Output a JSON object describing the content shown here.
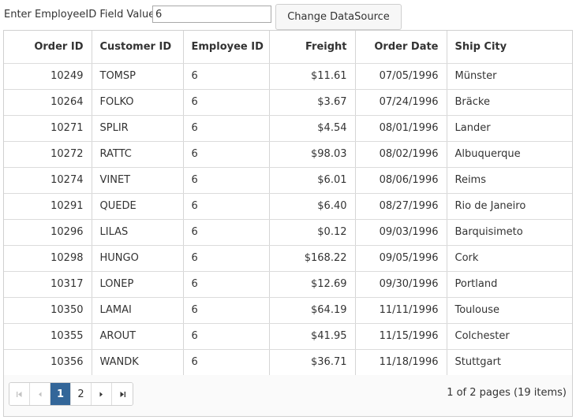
{
  "toolbar": {
    "label": "Enter EmployeeID Field Value:",
    "input_value": "6",
    "button_label": "Change DataSource"
  },
  "grid": {
    "columns": [
      "Order ID",
      "Customer ID",
      "Employee ID",
      "Freight",
      "Order Date",
      "Ship City"
    ],
    "rows": [
      [
        "10249",
        "TOMSP",
        "6",
        "$11.61",
        "07/05/1996",
        "Münster"
      ],
      [
        "10264",
        "FOLKO",
        "6",
        "$3.67",
        "07/24/1996",
        "Bräcke"
      ],
      [
        "10271",
        "SPLIR",
        "6",
        "$4.54",
        "08/01/1996",
        "Lander"
      ],
      [
        "10272",
        "RATTC",
        "6",
        "$98.03",
        "08/02/1996",
        "Albuquerque"
      ],
      [
        "10274",
        "VINET",
        "6",
        "$6.01",
        "08/06/1996",
        "Reims"
      ],
      [
        "10291",
        "QUEDE",
        "6",
        "$6.40",
        "08/27/1996",
        "Rio de Janeiro"
      ],
      [
        "10296",
        "LILAS",
        "6",
        "$0.12",
        "09/03/1996",
        "Barquisimeto"
      ],
      [
        "10298",
        "HUNGO",
        "6",
        "$168.22",
        "09/05/1996",
        "Cork"
      ],
      [
        "10317",
        "LONEP",
        "6",
        "$12.69",
        "09/30/1996",
        "Portland"
      ],
      [
        "10350",
        "LAMAI",
        "6",
        "$64.19",
        "11/11/1996",
        "Toulouse"
      ],
      [
        "10355",
        "AROUT",
        "6",
        "$41.95",
        "11/15/1996",
        "Colchester"
      ],
      [
        "10356",
        "WANDK",
        "6",
        "$36.71",
        "11/18/1996",
        "Stuttgart"
      ]
    ]
  },
  "pager": {
    "pages": [
      "1",
      "2"
    ],
    "current_page": "1",
    "info": "1 of 2 pages (19 items)",
    "icons": [
      "first-page-icon",
      "previous-page-icon",
      "next-page-icon",
      "last-page-icon"
    ]
  },
  "colors": {
    "active_page": "#336699",
    "border": "#d0d0d0",
    "text": "#333333"
  }
}
